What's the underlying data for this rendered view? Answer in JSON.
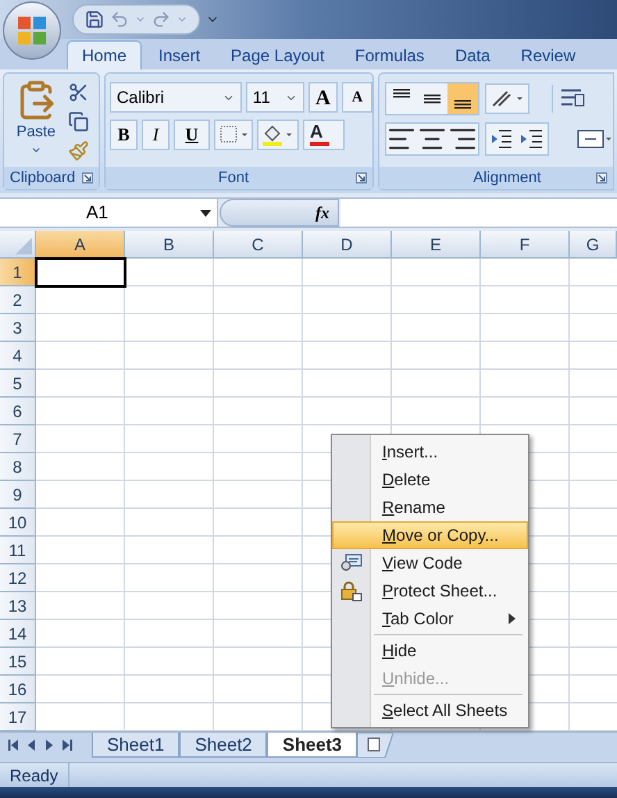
{
  "ribbon_tabs": [
    {
      "label": "Home",
      "selected": true
    },
    {
      "label": "Insert",
      "selected": false
    },
    {
      "label": "Page Layout",
      "selected": false
    },
    {
      "label": "Formulas",
      "selected": false
    },
    {
      "label": "Data",
      "selected": false
    },
    {
      "label": "Review",
      "selected": false
    }
  ],
  "clipboard": {
    "paste_label": "Paste",
    "group_label": "Clipboard"
  },
  "font": {
    "family": "Calibri",
    "size": "11",
    "grow_label": "A",
    "shrink_label": "A",
    "bold_label": "B",
    "italic_label": "I",
    "underline_label": "U",
    "font_color_label": "A",
    "group_label": "Font"
  },
  "alignment": {
    "group_label": "Alignment",
    "vertical_align": [
      {
        "selected": false
      },
      {
        "selected": false
      },
      {
        "selected": true
      }
    ]
  },
  "formula_bar": {
    "name_box": "A1",
    "fx_label": "fx"
  },
  "columns": [
    {
      "label": "A",
      "selected": true
    },
    {
      "label": "B",
      "selected": false
    },
    {
      "label": "C",
      "selected": false
    },
    {
      "label": "D",
      "selected": false
    },
    {
      "label": "E",
      "selected": false
    },
    {
      "label": "F",
      "selected": false
    },
    {
      "label": "G",
      "selected": false
    }
  ],
  "rows": [
    {
      "label": "1",
      "selected": true
    },
    {
      "label": "2",
      "selected": false
    },
    {
      "label": "3",
      "selected": false
    },
    {
      "label": "4",
      "selected": false
    },
    {
      "label": "5",
      "selected": false
    },
    {
      "label": "6",
      "selected": false
    },
    {
      "label": "7",
      "selected": false
    },
    {
      "label": "8",
      "selected": false
    },
    {
      "label": "9",
      "selected": false
    },
    {
      "label": "10",
      "selected": false
    },
    {
      "label": "11",
      "selected": false
    },
    {
      "label": "12",
      "selected": false
    },
    {
      "label": "13",
      "selected": false
    },
    {
      "label": "14",
      "selected": false
    },
    {
      "label": "15",
      "selected": false
    },
    {
      "label": "16",
      "selected": false
    },
    {
      "label": "17",
      "selected": false
    }
  ],
  "sheet_tabs": [
    {
      "label": "Sheet1",
      "selected": false
    },
    {
      "label": "Sheet2",
      "selected": false
    },
    {
      "label": "Sheet3",
      "selected": true
    }
  ],
  "context_menu": {
    "items": [
      {
        "kind": "plain",
        "label": "Insert...",
        "highlighted": false,
        "disabled": false
      },
      {
        "kind": "plain",
        "label": "Delete",
        "highlighted": false,
        "disabled": false
      },
      {
        "kind": "plain",
        "label": "Rename",
        "highlighted": false,
        "disabled": false
      },
      {
        "kind": "plain",
        "label": "Move or Copy...",
        "highlighted": true,
        "disabled": false
      },
      {
        "kind": "view_code",
        "label": "View Code",
        "highlighted": false,
        "disabled": false
      },
      {
        "kind": "protect",
        "label": "Protect Sheet...",
        "highlighted": false,
        "disabled": false
      },
      {
        "kind": "submenu",
        "label": "Tab Color",
        "highlighted": false,
        "disabled": false
      },
      {
        "kind": "separator"
      },
      {
        "kind": "plain",
        "label": "Hide",
        "highlighted": false,
        "disabled": false
      },
      {
        "kind": "plain",
        "label": "Unhide...",
        "highlighted": false,
        "disabled": true
      },
      {
        "kind": "separator"
      },
      {
        "kind": "plain",
        "label": "Select All Sheets",
        "highlighted": false,
        "disabled": false
      }
    ]
  },
  "status_bar": {
    "text": "Ready"
  }
}
